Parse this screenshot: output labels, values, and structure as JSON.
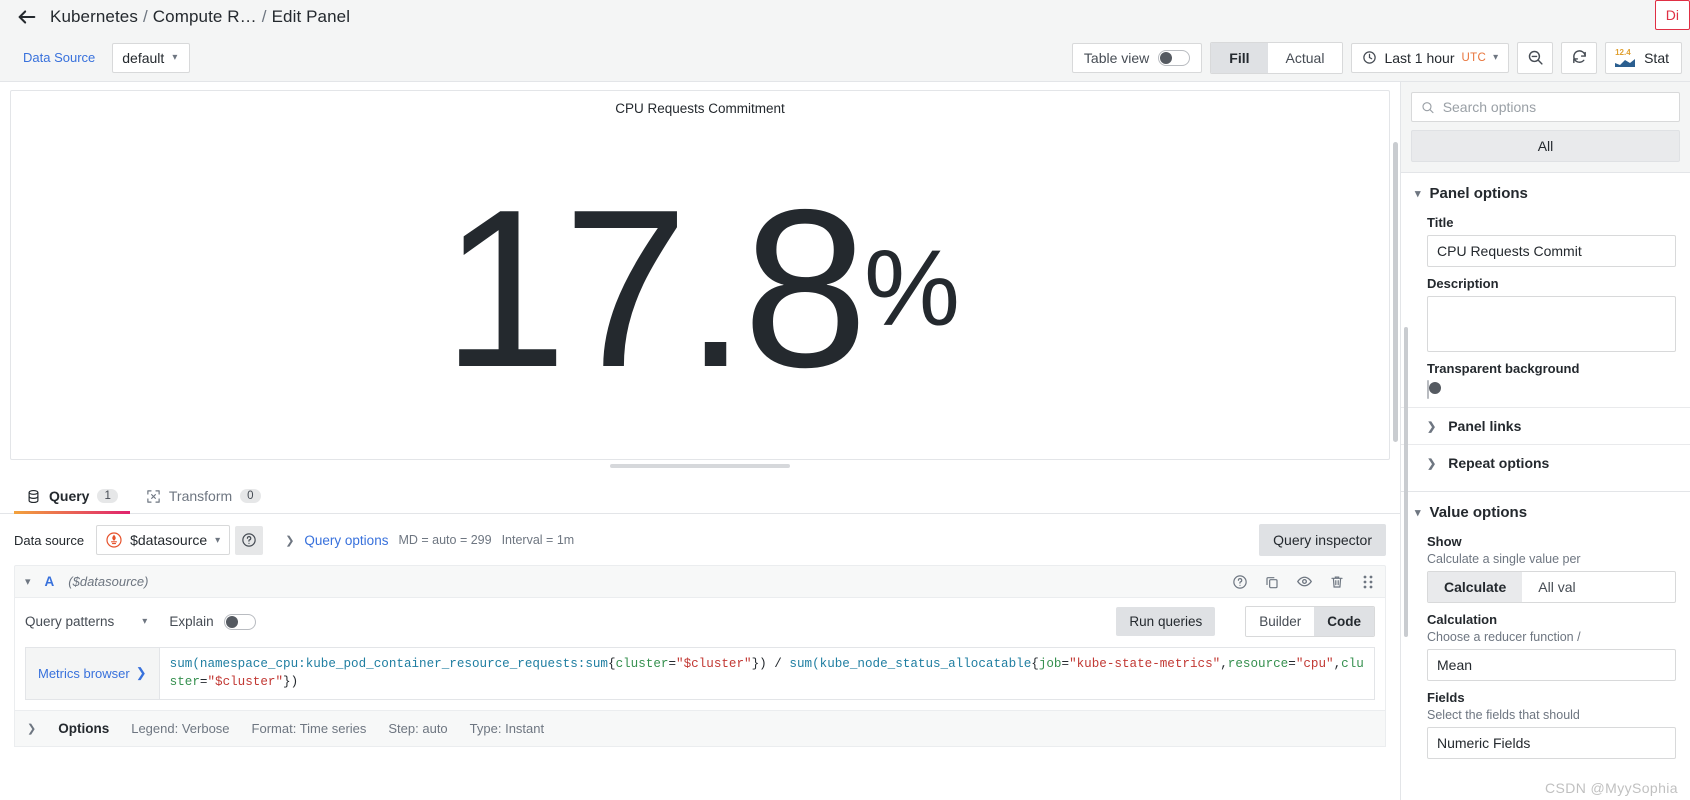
{
  "header": {
    "back_icon": "arrow-left-icon",
    "breadcrumb": {
      "dashboard": "Kubernetes",
      "folder": "Compute R…",
      "page": "Edit Panel",
      "sep": "/"
    },
    "discard_label": "Di"
  },
  "toolbar": {
    "datasource_label": "Data Source",
    "datasource_value": "default",
    "table_view_label": "Table view",
    "table_view_on": false,
    "fill_label": "Fill",
    "actual_label": "Actual",
    "fill_active": true,
    "time_range": "Last 1 hour",
    "timezone": "UTC",
    "zoom_out_icon": "zoom-out-icon",
    "refresh_icon": "refresh-icon",
    "viz_type": "Stat",
    "viz_glyph_value": "12.4"
  },
  "panel": {
    "title": "CPU Requests Commitment",
    "value": "17.8",
    "unit": "%"
  },
  "tabs": [
    {
      "label": "Query",
      "count": "1",
      "icon": "database-icon",
      "active": true
    },
    {
      "label": "Transform",
      "count": "0",
      "icon": "transform-icon",
      "active": false
    }
  ],
  "query_editor": {
    "datasource_label": "Data source",
    "datasource_value": "$datasource",
    "datasource_icon": "prometheus-icon",
    "help_icon": "help-circle-icon",
    "query_options_label": "Query options",
    "query_options_meta_md": "MD = auto = 299",
    "query_options_meta_interval": "Interval = 1m",
    "query_inspector_label": "Query inspector",
    "row": {
      "ref_id": "A",
      "datasource": "($datasource)",
      "icons": [
        "help-circle-icon",
        "copy-icon",
        "eye-icon",
        "trash-icon",
        "drag-handle-icon"
      ]
    },
    "query_patterns_label": "Query patterns",
    "explain_label": "Explain",
    "explain_on": false,
    "run_queries_label": "Run queries",
    "builder_label": "Builder",
    "code_label": "Code",
    "mode_active": "Code",
    "metrics_browser_label": "Metrics browser",
    "expression_tokens": [
      {
        "t": "sum(namespace_cpu:kube_pod_container_resource_requests:sum",
        "c": "fn"
      },
      {
        "t": "{",
        "c": "punct"
      },
      {
        "t": "cluster",
        "c": "label"
      },
      {
        "t": "=",
        "c": "punct"
      },
      {
        "t": "\"$cluster\"",
        "c": "str"
      },
      {
        "t": "}) / ",
        "c": "punct"
      },
      {
        "t": "sum(kube_node_status_allocatable",
        "c": "fn"
      },
      {
        "t": "{",
        "c": "punct"
      },
      {
        "t": "job",
        "c": "label"
      },
      {
        "t": "=",
        "c": "punct"
      },
      {
        "t": "\"kube-state-metrics\"",
        "c": "str"
      },
      {
        "t": ",",
        "c": "punct"
      },
      {
        "t": "resource",
        "c": "label"
      },
      {
        "t": "=",
        "c": "punct"
      },
      {
        "t": "\"cpu\"",
        "c": "str"
      },
      {
        "t": ",",
        "c": "punct"
      },
      {
        "t": "cluster",
        "c": "label"
      },
      {
        "t": "=",
        "c": "punct"
      },
      {
        "t": "\"$cluster\"",
        "c": "str"
      },
      {
        "t": "})",
        "c": "punct"
      }
    ],
    "options_bar": {
      "title": "Options",
      "legend": "Legend: Verbose",
      "format": "Format: Time series",
      "step": "Step: auto",
      "type": "Type: Instant"
    }
  },
  "sidebar": {
    "search_placeholder": "Search options",
    "search_value": "",
    "search_icon": "search-icon",
    "all_tab_label": "All",
    "panel_options": {
      "section_label": "Panel options",
      "title_label": "Title",
      "title_value": "CPU Requests Commit",
      "description_label": "Description",
      "description_value": "",
      "transparent_label": "Transparent background",
      "transparent_on": false,
      "panel_links_label": "Panel links",
      "repeat_options_label": "Repeat options"
    },
    "value_options": {
      "section_label": "Value options",
      "show_label": "Show",
      "show_desc": "Calculate a single value per",
      "show_calculate": "Calculate",
      "show_all_values": "All val",
      "show_active": "Calculate",
      "calculation_label": "Calculation",
      "calculation_desc": "Choose a reducer function /",
      "calculation_value": "Mean",
      "fields_label": "Fields",
      "fields_desc": "Select the fields that should",
      "fields_value": "Numeric Fields"
    }
  },
  "watermark": "CSDN @MyySophia",
  "colors": {
    "accent_blue": "#3871dc",
    "accent_orange": "#e8743b",
    "tab_underline_a": "#f2a23c",
    "tab_underline_b": "#e0226e",
    "danger": "#e02f44",
    "text": "#24292e",
    "muted": "#6e7681"
  }
}
